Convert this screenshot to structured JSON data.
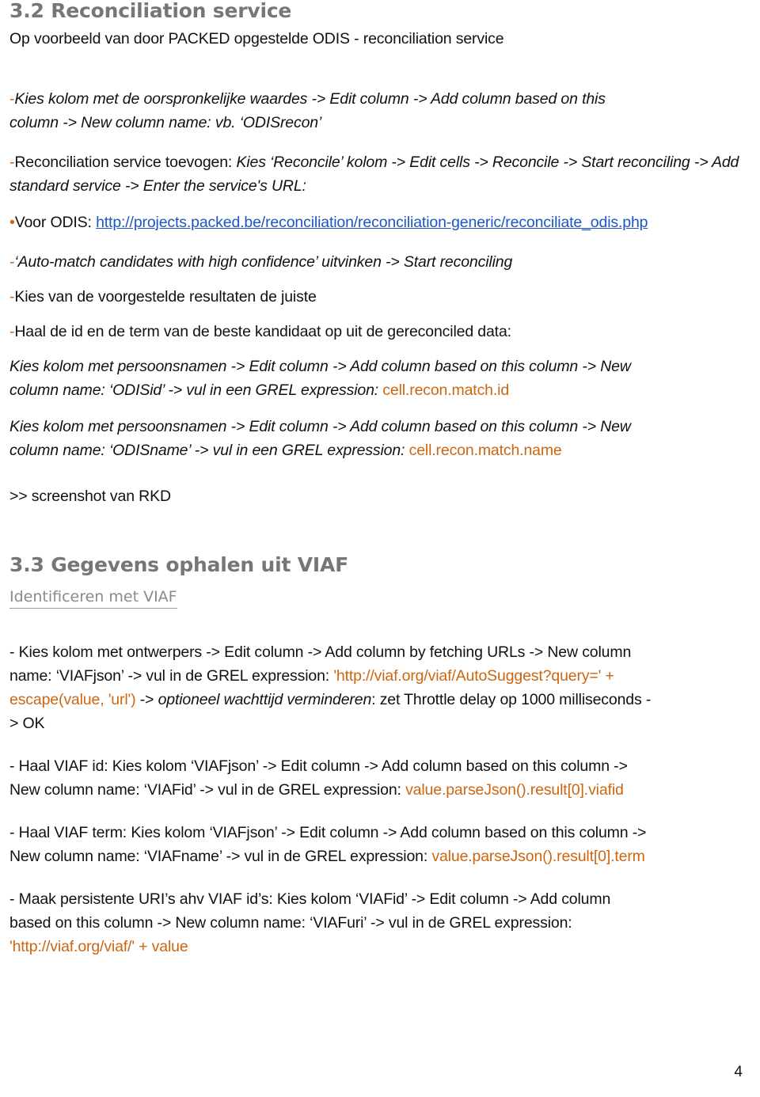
{
  "document": {
    "page_number": "4",
    "colors": {
      "heading_gray": "#767676",
      "accent_orange": "#cc6611",
      "link_blue": "#1a56c4",
      "body_black": "#111111",
      "background": "#ffffff"
    }
  },
  "section_32": {
    "heading": "3.2 Reconciliation service",
    "intro": "Op voorbeeld van door PACKED opgestelde ODIS - reconciliation service",
    "step1": {
      "dash": "-",
      "line1": "Kies kolom met de oorspronkelijke waardes -> Edit column -> Add column based on this",
      "line2_a": "column -> New column name: vb. ",
      "line2_b": "‘ODISrecon’"
    },
    "step2": {
      "dash": "-",
      "plain1": "Reconciliation service toevogen: ",
      "italic1": "Kies ‘Reconcile’ kolom -> Edit cells -> Reconcile  -> Start reconciling -> Add standard service -> Enter the service's URL:"
    },
    "url_line": {
      "bullet": "•",
      "label": "Voor ODIS: ",
      "url": "http://projects.packed.be/reconciliation/reconciliation-generic/reconciliate_odis.php"
    },
    "step3": {
      "dash": "-",
      "text": "‘Auto-match candidates with high confidence’ uitvinken -> Start reconciling"
    },
    "step4": {
      "dash": "-",
      "text": "Kies van de voorgestelde resultaten de juiste"
    },
    "step5": {
      "dash": "-",
      "text": "Haal de id en de term van de beste kandidaat op uit de gereconciled data:"
    },
    "odisid_block": {
      "line1": "Kies kolom met persoonsnamen -> Edit column -> Add column based on this column -> New",
      "line2_a": "column name: ‘ODISid’  -> vul in een GREL expression: ",
      "grel": "cell.recon.match.id"
    },
    "odisname_block": {
      "line1": "Kies kolom met persoonsnamen -> Edit column -> Add column based on this column -> New",
      "line2_a": "column name: ‘ODISname’  -> vul in een GREL expression: ",
      "grel": "cell.recon.match.name"
    },
    "screenshot_note": ">> screenshot van RKD"
  },
  "section_33": {
    "heading": "3.3 Gegevens ophalen uit VIAF",
    "subheading": "Identificeren met VIAF",
    "viafjson_block": {
      "line1": "- Kies kolom met ontwerpers -> Edit column -> Add column by fetching URLs -> New column",
      "line2_a": "name: ‘VIAFjson’ -> vul in de GREL expression: ",
      "grel1": "'http://viaf.org/viaf/AutoSuggest?query=' +",
      "grel2": "escape(value, 'url')",
      "line3_a": " -> ",
      "line3_italic": "optioneel wachttijd verminderen",
      "line3_b": ": zet Throttle delay op 1000 milliseconds -",
      "line4": "> OK"
    },
    "viafid_block": {
      "line1": "- Haal VIAF id: Kies kolom ‘VIAFjson’ -> Edit column -> Add column based on this column ->",
      "line2_a": "New column name: ‘VIAFid’ -> vul in de GREL expression: ",
      "grel": "value.parseJson().result[0].viafid"
    },
    "viafterm_block": {
      "line1": "- Haal VIAF term: Kies kolom ‘VIAFjson’ -> Edit column -> Add column based on this column ->",
      "line2_a": "New column name: ‘VIAFname’ -> vul in de GREL expression: ",
      "grel": "value.parseJson().result[0].term"
    },
    "viafuri_block": {
      "line1": "- Maak persistente URI’s ahv VIAF id’s: Kies kolom ‘VIAFid’ -> Edit column -> Add column",
      "line2": "based on this column -> New column name: ‘VIAFuri’ -> vul in de GREL expression:",
      "grel": "'http://viaf.org/viaf/' + value"
    }
  }
}
